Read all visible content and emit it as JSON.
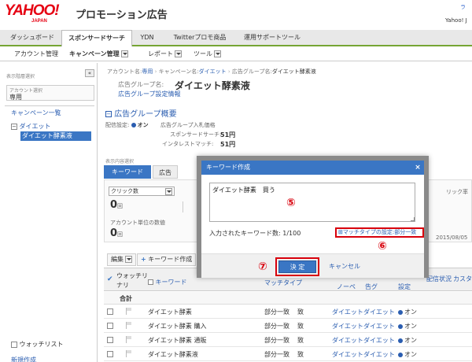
{
  "header": {
    "logo": "YAHOO!",
    "logo_sub": "JAPAN",
    "title": "プロモーション広告",
    "right_link": "ラ",
    "right_user": "Yahoo! J"
  },
  "main_tabs": [
    "ダッシュボード",
    "スポンサードサーチ",
    "YDN",
    "Twitterプロモ商品",
    "運用サポートツール"
  ],
  "sub_nav": {
    "account_mgmt": "アカウント管理",
    "campaign_mgmt": "キャンペーン管理",
    "report": "レポート",
    "tools": "ツール"
  },
  "sidebar": {
    "collapse": "«",
    "display_label": "表示階層選択",
    "account_label": "アカウント選択",
    "account_value": "専用",
    "campaign_list": "キャンペーン一覧",
    "campaign_name": "ダイエット",
    "ad_group_name": "ダイエット酵素液",
    "watchlist": "ウォッチリスト",
    "new_create": "新規作成"
  },
  "breadcrumb": {
    "account_label": "アカウント名:",
    "account_value": "専用",
    "campaign_label": "キャンペーン名:",
    "campaign_value": "ダイエット",
    "group_label": "広告グループ名:",
    "group_value": "ダイエット酵素液"
  },
  "adgroup": {
    "label": "広告グループ名:",
    "name": "ダイエット酵素液",
    "settings_link": "広告グループ設定情報",
    "overview_title": "広告グループ概要",
    "delivery_label": "配信設定:",
    "delivery_value": "オン",
    "bid_label": "広告グループ入札価格",
    "sponsored_label": "スポンサードサーチ:",
    "sponsored_value": "51円",
    "interest_label": "インタレストマッチ:",
    "interest_value": "51円"
  },
  "content_tabs": {
    "display_label": "表示内容選択",
    "keyword": "キーワード",
    "ad": "広告"
  },
  "stats": {
    "metric_select": "クリック数",
    "metric_value": "0",
    "metric_unit": "回",
    "account_unit_label": "アカウント単位の数値",
    "account_value": "0",
    "account_unit": "回",
    "right_label": "リック率",
    "date": "2015/08/05"
  },
  "table": {
    "edit_button": "編集",
    "create_button": "キーワード作成",
    "col_watch": "ウォッチリ",
    "col_keyword": "キーワード",
    "col_match": "マッチタイプ",
    "col_url": "ノーペ",
    "col_status": "告グ",
    "col_setting": "設定",
    "col_delivery": "配信状況",
    "col_bid": "カスタ",
    "total_label": "合計",
    "rows": [
      {
        "keyword": "ダイエット酵素",
        "match": "部分一致",
        "extra": "致",
        "campaign": "ダイエット",
        "group": "ダイエット",
        "status": "オン"
      },
      {
        "keyword": "ダイエット酵素 購入",
        "match": "部分一致",
        "extra": "致",
        "campaign": "ダイエット",
        "group": "ダイエット",
        "status": "オン"
      },
      {
        "keyword": "ダイエット酵素 通販",
        "match": "部分一致",
        "extra": "致",
        "campaign": "ダイエット",
        "group": "ダイエット",
        "status": "オン"
      },
      {
        "keyword": "ダイエット酵素液",
        "match": "部分一致",
        "extra": "致",
        "campaign": "ダイエット",
        "group": "ダイエット",
        "status": "オン"
      }
    ]
  },
  "modal": {
    "title": "キーワード作成",
    "close": "×",
    "textarea_value": "ダイエット酵素　買う",
    "count_label": "入力されたキーワード数: 1/100",
    "match_link": "マッチタイプの設定:部分一致",
    "ok": "決 定",
    "cancel": "キャンセル"
  },
  "callouts": {
    "five": "⑤",
    "six": "⑥",
    "seven": "⑦"
  },
  "colors": {
    "brand_red": "#e60012",
    "accent_blue": "#3a76c4",
    "link_blue": "#2a5db0",
    "tab_green": "#76a534",
    "highlight_red": "#d8000c"
  }
}
